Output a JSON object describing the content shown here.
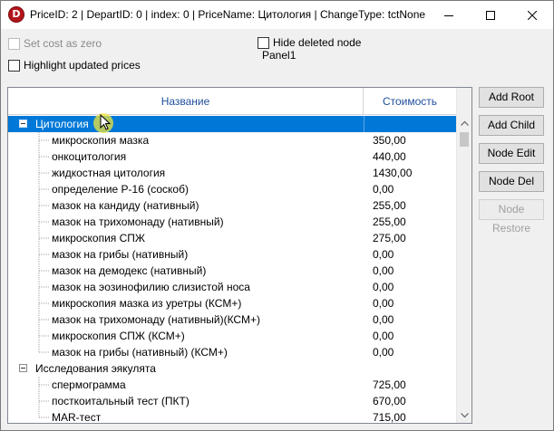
{
  "window": {
    "app_icon_letter": "D",
    "title": "PriceID: 2 | DepartID: 0 | index: 0 | PriceName: Цитология | ChangeType: tctNone |..."
  },
  "options": {
    "set_cost_zero": "Set cost as zero",
    "hide_deleted": "Hide deleted node",
    "highlight_updated": "Highlight updated prices",
    "panel_caption": "Panel1"
  },
  "tree": {
    "columns": {
      "name": "Название",
      "cost": "Стоимость"
    },
    "rows": [
      {
        "name": "Цитология",
        "cost": "",
        "level": 0,
        "expander": true,
        "selected": true
      },
      {
        "name": "микроскопия мазка",
        "cost": "350,00",
        "level": 1
      },
      {
        "name": "онкоцитология",
        "cost": "440,00",
        "level": 1
      },
      {
        "name": "жидкостная цитология",
        "cost": "1430,00",
        "level": 1
      },
      {
        "name": "определение Р-16 (соскоб)",
        "cost": "0,00",
        "level": 1
      },
      {
        "name": "мазок на кандиду (нативный)",
        "cost": "255,00",
        "level": 1
      },
      {
        "name": "мазок на трихомонаду (нативный)",
        "cost": "255,00",
        "level": 1
      },
      {
        "name": "микроскопия СПЖ",
        "cost": "275,00",
        "level": 1
      },
      {
        "name": "мазок на грибы (нативный)",
        "cost": "0,00",
        "level": 1
      },
      {
        "name": "мазок на демодекс (нативный)",
        "cost": "0,00",
        "level": 1
      },
      {
        "name": "мазок на эозинофилию слизистой носа",
        "cost": "0,00",
        "level": 1
      },
      {
        "name": "микроскопия мазка из уретры (КСМ+)",
        "cost": "0,00",
        "level": 1
      },
      {
        "name": "мазок на трихомонаду (нативный)(КСМ+)",
        "cost": "0,00",
        "level": 1
      },
      {
        "name": "микроскопия СПЖ (КСМ+)",
        "cost": "0,00",
        "level": 1
      },
      {
        "name": "мазок на грибы (нативный) (КСМ+)",
        "cost": "0,00",
        "level": 1
      },
      {
        "name": "Исследования эякулята",
        "cost": "",
        "level": 0,
        "expander": true
      },
      {
        "name": "спермограмма",
        "cost": "725,00",
        "level": 1
      },
      {
        "name": "посткоитальный тест (ПКТ)",
        "cost": "670,00",
        "level": 1
      },
      {
        "name": "MAR-тест",
        "cost": "715,00",
        "level": 1
      }
    ]
  },
  "buttons": {
    "add_root": "Add Root",
    "add_child": "Add Child",
    "node_edit": "Node Edit",
    "node_del": "Node Del",
    "node_restore": "Node Restore"
  },
  "icons": {
    "minimize": "minimize-icon",
    "maximize": "maximize-icon",
    "close": "close-icon",
    "scroll_up": "scroll-up-arrow-icon",
    "scroll_down": "scroll-down-arrow-icon",
    "cursor": "mouse-cursor-icon"
  },
  "colors": {
    "selection": "#0078d7",
    "header_text": "#1f4e9c",
    "app_icon": "#b3151b"
  }
}
